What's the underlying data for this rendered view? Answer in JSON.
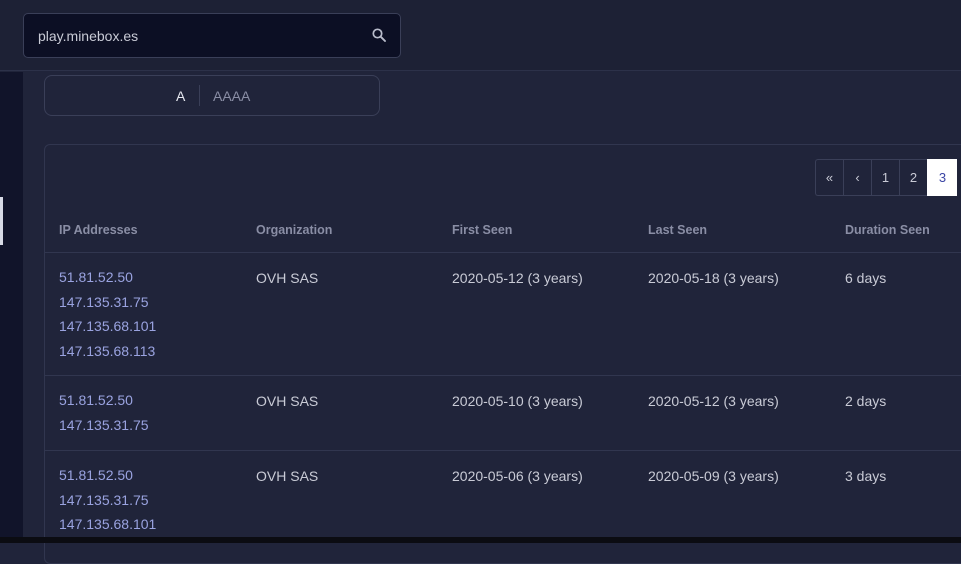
{
  "search": {
    "value": "play.minebox.es"
  },
  "record_types": [
    "A",
    "AAAA"
  ],
  "pagination": {
    "first": "«",
    "prev": "‹",
    "pages": [
      "1",
      "2",
      "3"
    ],
    "active": "3"
  },
  "table": {
    "headers": {
      "ips": "IP Addresses",
      "org": "Organization",
      "first_seen": "First Seen",
      "last_seen": "Last Seen",
      "duration": "Duration Seen"
    },
    "rows": [
      {
        "ips": [
          "51.81.52.50",
          "147.135.31.75",
          "147.135.68.101",
          "147.135.68.113"
        ],
        "org": "OVH SAS",
        "first_seen": "2020-05-12 (3 years)",
        "last_seen": "2020-05-18 (3 years)",
        "duration": "6 days"
      },
      {
        "ips": [
          "51.81.52.50",
          "147.135.31.75"
        ],
        "org": "OVH SAS",
        "first_seen": "2020-05-10 (3 years)",
        "last_seen": "2020-05-12 (3 years)",
        "duration": "2 days"
      },
      {
        "ips": [
          "51.81.52.50",
          "147.135.31.75",
          "147.135.68.101"
        ],
        "org": "OVH SAS",
        "first_seen": "2020-05-06 (3 years)",
        "last_seen": "2020-05-09 (3 years)",
        "duration": "3 days"
      }
    ]
  },
  "icons": {
    "search": "search-icon"
  },
  "colors": {
    "background": "#20243a",
    "link": "#9aa3e0",
    "active_page_text": "#3b45a5"
  }
}
